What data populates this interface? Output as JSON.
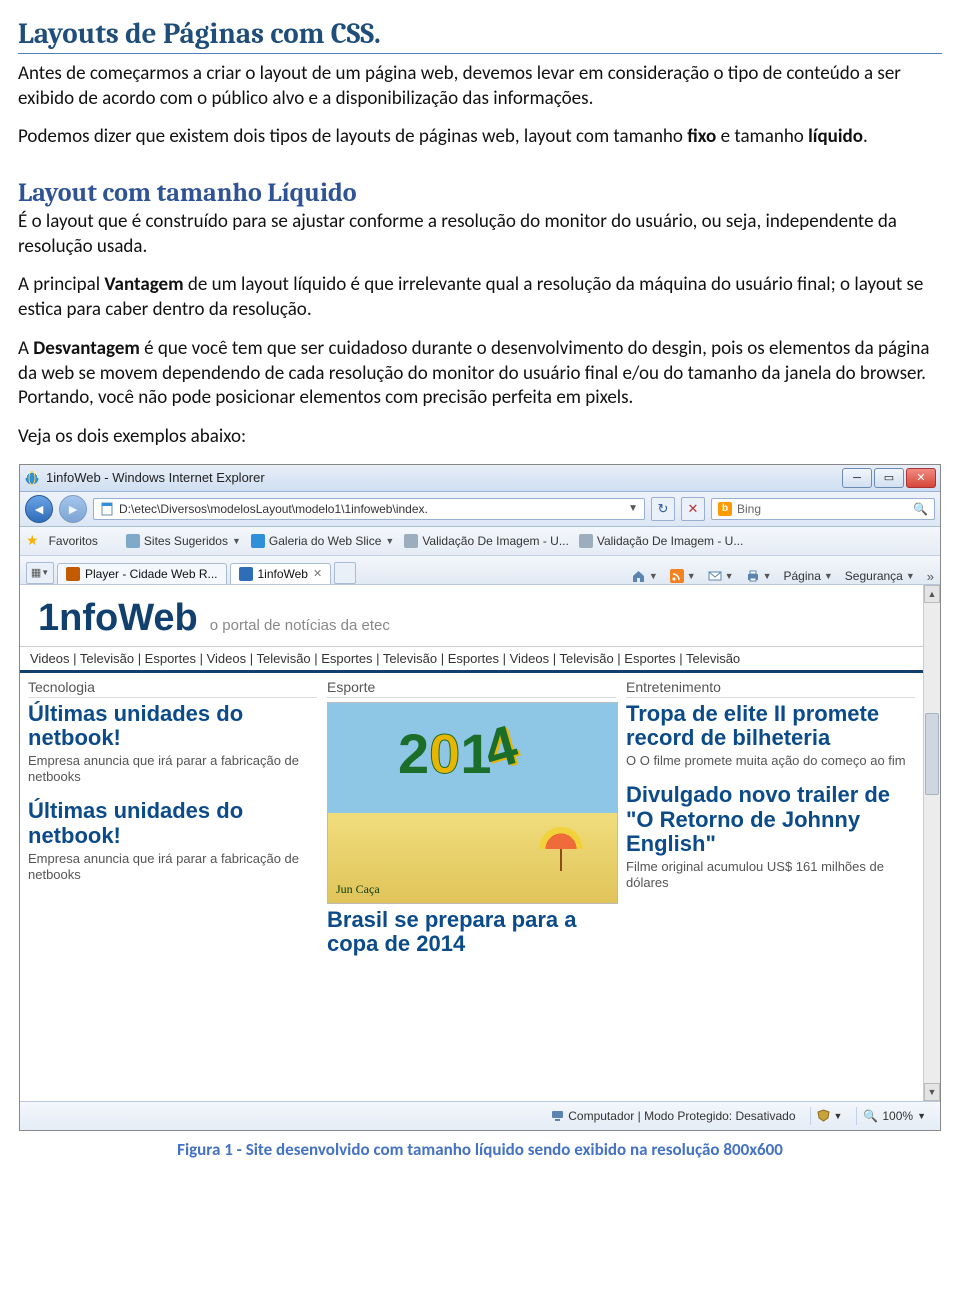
{
  "doc": {
    "title": "Layouts de Páginas com CSS.",
    "p1a": "Antes de começarmos a criar o layout de um página web, devemos levar em consideração o tipo de conteúdo a ser exibido de acordo com o público alvo e a disponibilização das informações.",
    "p2_pre": "Podemos dizer que existem dois tipos de layouts de páginas web, layout com tamanho ",
    "p2_fixo": "fixo",
    "p2_mid": " e tamanho ",
    "p2_liq": "líquido",
    "p2_end": ".",
    "h2": "Layout com tamanho Líquido",
    "p3": "É o layout que é construído para se ajustar conforme a resolução do monitor do usuário, ou seja, independente da resolução usada.",
    "p4_pre": "A principal ",
    "p4_b": "Vantagem",
    "p4_post": " de um layout líquido é que irrelevante qual a resolução da máquina do usuário final; o layout se estica para caber dentro da resolução.",
    "p5_pre": "A ",
    "p5_b": "Desvantagem",
    "p5_post": " é que você tem que ser cuidadoso durante o desenvolvimento do desgin, pois os elementos da página da web se movem dependendo de cada resolução do monitor do usuário final e/ou do tamanho da janela do browser. Portando, você não pode posicionar elementos com precisão perfeita em pixels.",
    "p6": "Veja os dois exemplos abaixo:",
    "caption": "Figura 1 - Site desenvolvido com tamanho líquido sendo exibido na resolução 800x600"
  },
  "ie": {
    "title": "1infoWeb - Windows Internet Explorer",
    "address": "D:\\etec\\Diversos\\modelosLayout\\modelo1\\1infoweb\\index.",
    "search_placeholder": "Bing",
    "fav_label": "Favoritos",
    "fav_items": [
      "Sites Sugeridos",
      "Galeria do Web Slice",
      "Validação De Imagem - U...",
      "Validação De Imagem - U..."
    ],
    "tabs": [
      "Player - Cidade Web R...",
      "1infoWeb"
    ],
    "cmd": {
      "pagina": "Página",
      "seguranca": "Segurança"
    },
    "status": {
      "mode": "Computador | Modo Protegido: Desativado",
      "zoom": "100%"
    }
  },
  "site": {
    "logo": "1nfoWeb",
    "tagline": "o portal de notícias da etec",
    "nav": "Videos | Televisão | Esportes | Videos | Televisão | Esportes | Televisão | Esportes | Videos | Televisão | Esportes | Televisão",
    "col1": {
      "header": "Tecnologia",
      "h1": "Últimas unidades do netbook!",
      "s1": "Empresa anuncia que irá parar a fabricação de netbooks",
      "h2": "Últimas unidades do netbook!",
      "s2": "Empresa anuncia que irá parar a fabricação de netbooks"
    },
    "col2": {
      "header": "Esporte",
      "headline": "Brasil se prepara para a copa de 2014",
      "sig": "Jun Caça"
    },
    "col3": {
      "header": "Entretenimento",
      "h1": "Tropa de elite II promete record de bilheteria",
      "s1": "O O filme promete muita ação do começo ao fim",
      "h2": "Divulgado novo trailer de \"O Retorno de Johnny English\"",
      "s2": "Filme original acumulou US$ 161 milhões de dólares"
    }
  }
}
